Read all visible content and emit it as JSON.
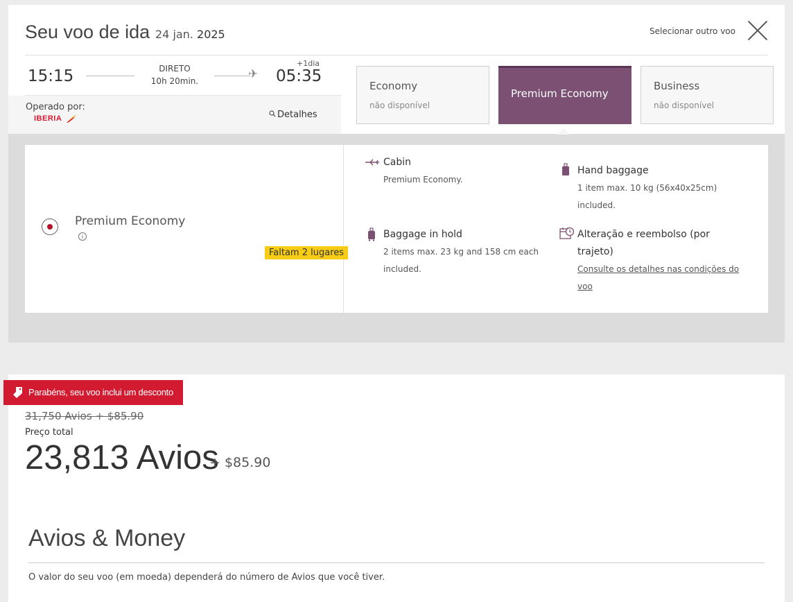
{
  "header": {
    "title": "Seu voo de ida",
    "date_day_month": "24 jan.",
    "date_year": "2025",
    "select_other": "Selecionar outro voo"
  },
  "flight": {
    "departure": "15:15",
    "arrival": "05:35",
    "type": "DIRETO",
    "duration": "10h 20min.",
    "plus_day": "+1dia",
    "operated_by_label": "Operado por:",
    "airline": "IBERIA",
    "details_label": "Detalhes"
  },
  "cabin_classes": [
    {
      "name": "Economy",
      "availability": "não disponível"
    },
    {
      "name": "Premium Economy",
      "availability": ""
    },
    {
      "name": "Business",
      "availability": "não disponível"
    }
  ],
  "fare": {
    "name": "Premium Economy",
    "seats_left": "Faltam 2 lugares",
    "features": {
      "cabin": {
        "title": "Cabin",
        "desc": "Premium Economy."
      },
      "hand_baggage": {
        "title": "Hand baggage",
        "desc1": "1 item max. 10 kg (56x40x25cm)",
        "desc2": "included."
      },
      "hold_baggage": {
        "title": "Baggage in hold",
        "desc1": "2 items max. 23 kg and 158 cm each",
        "desc2": "included."
      },
      "changes": {
        "title1": "Alteração e reembolso (por",
        "title2": "trajeto)",
        "link1": "Consulte os detalhes nas condições do",
        "link2": "voo"
      }
    }
  },
  "pricing": {
    "promo": "Parabéns, seu voo inclui um desconto",
    "old_price": "31,750 Avios + $85.90",
    "total_label": "Preço total",
    "avios": "23,813 Avios",
    "money": "+ $85.90"
  },
  "avios_money": {
    "title": "Avios & Money",
    "desc": "O valor do seu voo (em moeda) dependerá do número de Avios que você tiver."
  },
  "colors": {
    "accent": "#7b5073",
    "promo": "#d21b30",
    "badge": "#f6cc14"
  }
}
